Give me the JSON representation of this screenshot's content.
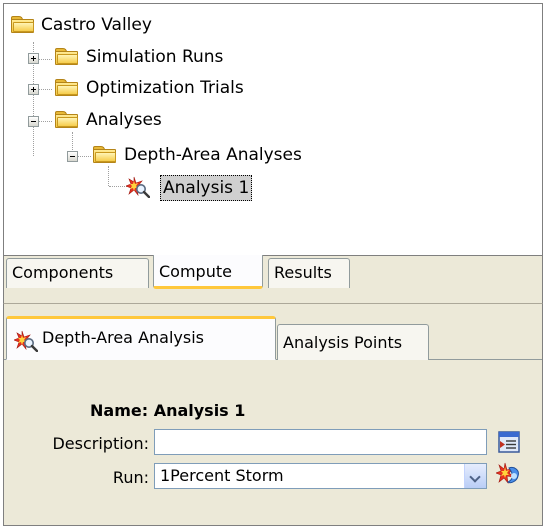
{
  "tree": {
    "items": [
      {
        "label": "Castro Valley",
        "expander": "none",
        "icon": "folder-icon",
        "level": 0
      },
      {
        "label": "Simulation Runs",
        "expander": "plus",
        "icon": "folder-icon",
        "level": 1
      },
      {
        "label": "Optimization Trials",
        "expander": "plus",
        "icon": "folder-icon",
        "level": 1
      },
      {
        "label": "Analyses",
        "expander": "minus",
        "icon": "folder-icon",
        "level": 1
      },
      {
        "label": "Depth-Area Analyses",
        "expander": "minus",
        "icon": "folder-icon",
        "level": 2
      },
      {
        "label": "Analysis 1",
        "expander": "none",
        "icon": "depth-area-analysis-icon",
        "level": 3,
        "selected": true
      }
    ]
  },
  "upper_tabs": [
    {
      "label": "Components",
      "active": false
    },
    {
      "label": "Compute",
      "active": true
    },
    {
      "label": "Results",
      "active": false
    }
  ],
  "lower_tabs": [
    {
      "label": "Depth-Area Analysis",
      "active": true,
      "icon": "depth-area-analysis-icon"
    },
    {
      "label": "Analysis Points",
      "active": false
    }
  ],
  "form": {
    "name_label": "Name:",
    "name_value": "Analysis 1",
    "description_label": "Description:",
    "description_value": "",
    "run_label": "Run:",
    "run_value": "1Percent Storm"
  },
  "colors": {
    "panel_background": "#ece9d8",
    "active_tab_accent": "#ffc83c",
    "selection_background": "#d0d0d0"
  }
}
